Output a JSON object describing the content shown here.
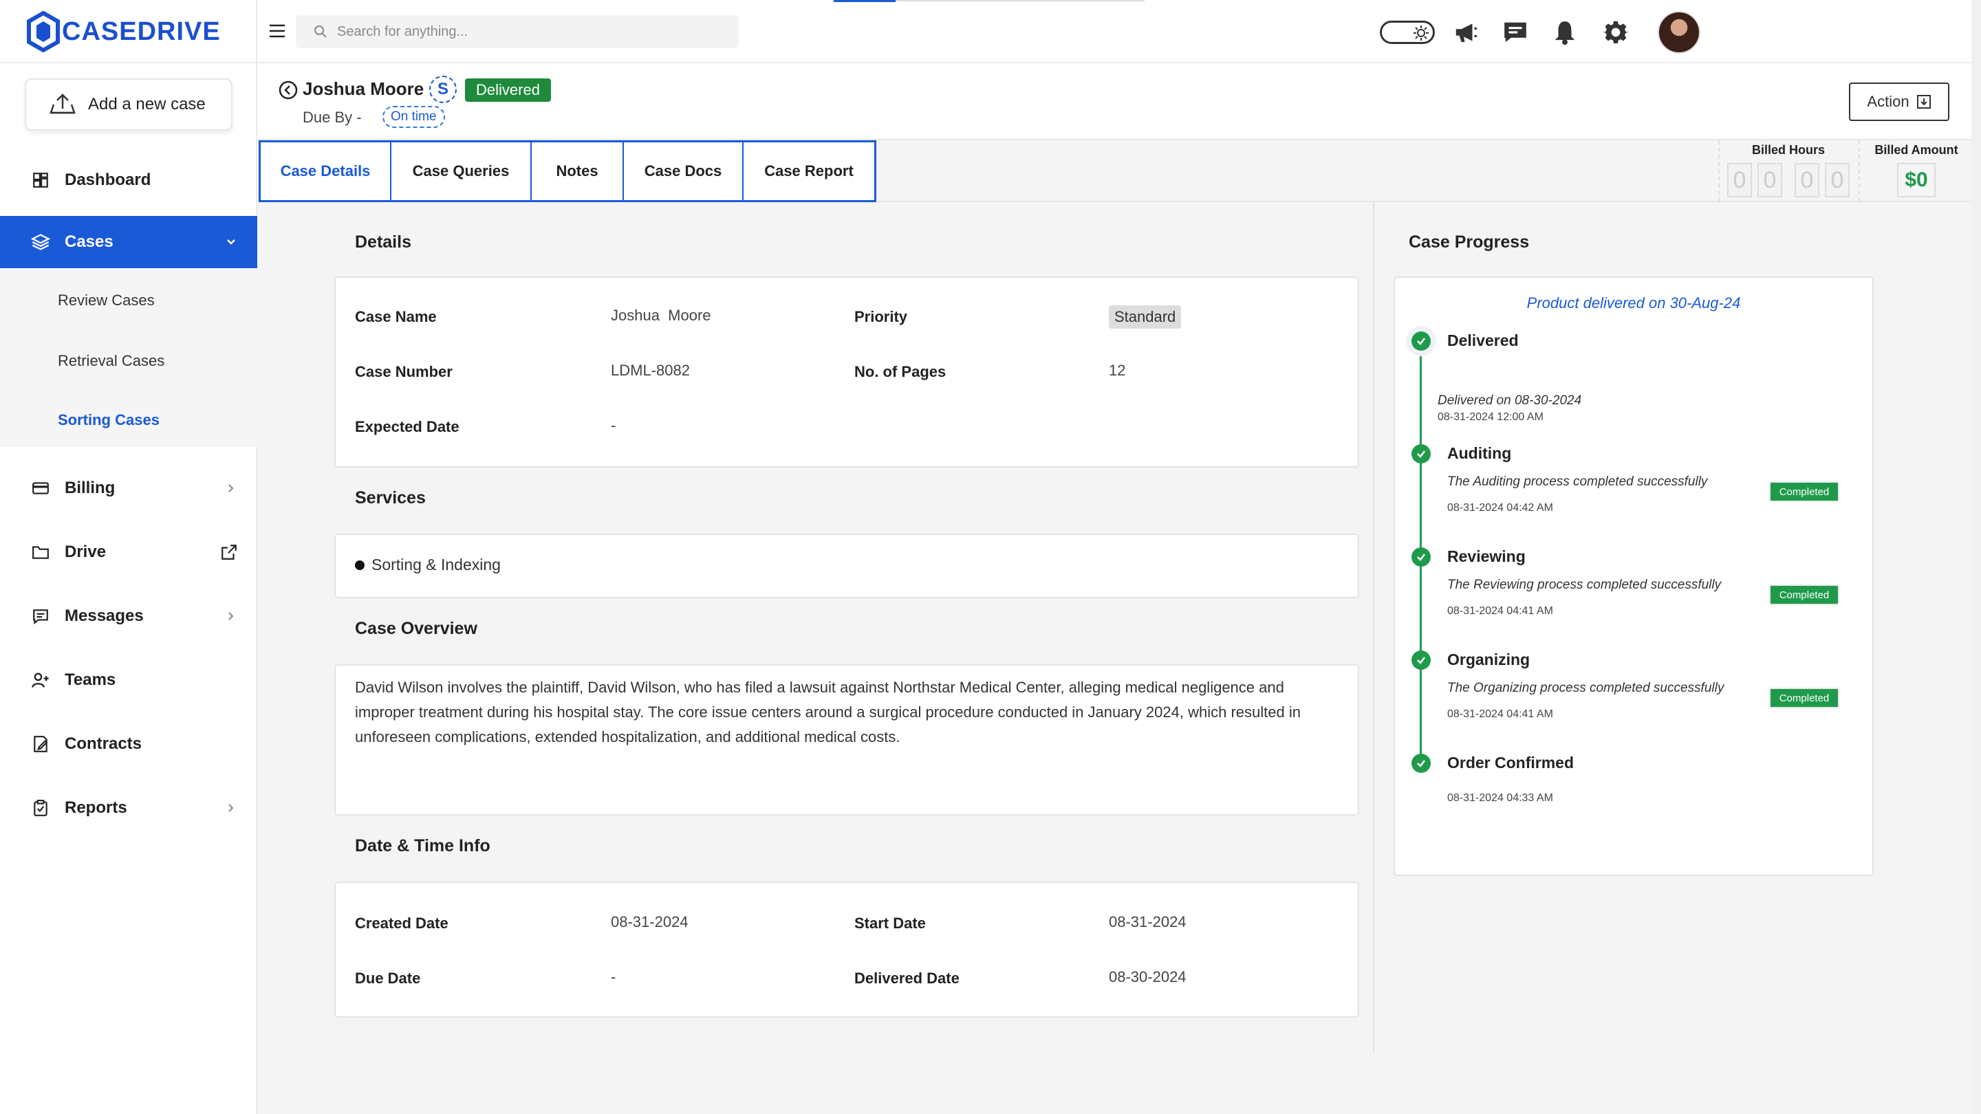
{
  "brand": {
    "name": "CASEDRIVE"
  },
  "sidebar": {
    "add_case_label": "Add a new case",
    "items": [
      {
        "label": "Dashboard",
        "icon": "dashboard-icon"
      },
      {
        "label": "Cases",
        "icon": "layers-icon"
      },
      {
        "label": "Billing",
        "icon": "card-icon"
      },
      {
        "label": "Drive",
        "icon": "folder-icon"
      },
      {
        "label": "Messages",
        "icon": "message-icon"
      },
      {
        "label": "Teams",
        "icon": "team-icon"
      },
      {
        "label": "Contracts",
        "icon": "contract-icon"
      },
      {
        "label": "Reports",
        "icon": "clipboard-icon"
      }
    ],
    "sub_items": [
      "Review Cases",
      "Retrieval Cases",
      "Sorting Cases"
    ]
  },
  "topbar": {
    "search_placeholder": "Search for anything..."
  },
  "header": {
    "case_name": "Joshua Moore",
    "initial": "S",
    "status": "Delivered",
    "due_label": "Due By -",
    "due_status": "On time",
    "action_label": "Action"
  },
  "tabs": [
    "Case Details",
    "Case Queries",
    "Notes",
    "Case Docs",
    "Case Report"
  ],
  "billing": {
    "hours_label": "Billed Hours",
    "hours_digits": [
      "0",
      "0",
      "0",
      "0"
    ],
    "amount_label": "Billed Amount",
    "amount": "$0"
  },
  "details": {
    "title": "Details",
    "case_name_label": "Case Name",
    "case_name_value": "Joshua  Moore",
    "priority_label": "Priority",
    "priority_value": "Standard",
    "case_number_label": "Case Number",
    "case_number_value": "LDML-8082",
    "pages_label": "No. of Pages",
    "pages_value": "12",
    "expected_label": "Expected Date",
    "expected_value": "-"
  },
  "services": {
    "title": "Services",
    "items": [
      "Sorting & Indexing"
    ]
  },
  "overview": {
    "title": "Case Overview",
    "text": "David Wilson involves the plaintiff, David Wilson, who has filed a lawsuit against Northstar Medical Center, alleging medical negligence and improper treatment during his hospital stay. The core issue centers around a surgical procedure conducted in January 2024, which resulted in unforeseen complications, extended hospitalization, and additional medical costs."
  },
  "dates": {
    "title": "Date & Time Info",
    "created_label": "Created Date",
    "created_value": "08-31-2024",
    "start_label": "Start Date",
    "start_value": "08-31-2024",
    "due_label": "Due Date",
    "due_value": "-",
    "delivered_label": "Delivered Date",
    "delivered_value": "08-30-2024"
  },
  "progress": {
    "title": "Case Progress",
    "headline": "Product delivered on 30-Aug-24",
    "steps": [
      {
        "name": "Delivered",
        "desc": "Delivered on 08-30-2024",
        "time": "08-31-2024 12:00 AM",
        "badge": ""
      },
      {
        "name": "Auditing",
        "desc": "The Auditing process completed successfully",
        "time": "08-31-2024 04:42 AM",
        "badge": "Completed"
      },
      {
        "name": "Reviewing",
        "desc": "The Reviewing process completed successfully",
        "time": "08-31-2024 04:41 AM",
        "badge": "Completed"
      },
      {
        "name": "Organizing",
        "desc": "The Organizing process completed successfully",
        "time": "08-31-2024 04:41 AM",
        "badge": "Completed"
      },
      {
        "name": "Order Confirmed",
        "desc": "",
        "time": "08-31-2024 04:33 AM",
        "badge": ""
      }
    ]
  },
  "colors": {
    "accent": "#1a5ad7",
    "success": "#1f8a3b"
  }
}
